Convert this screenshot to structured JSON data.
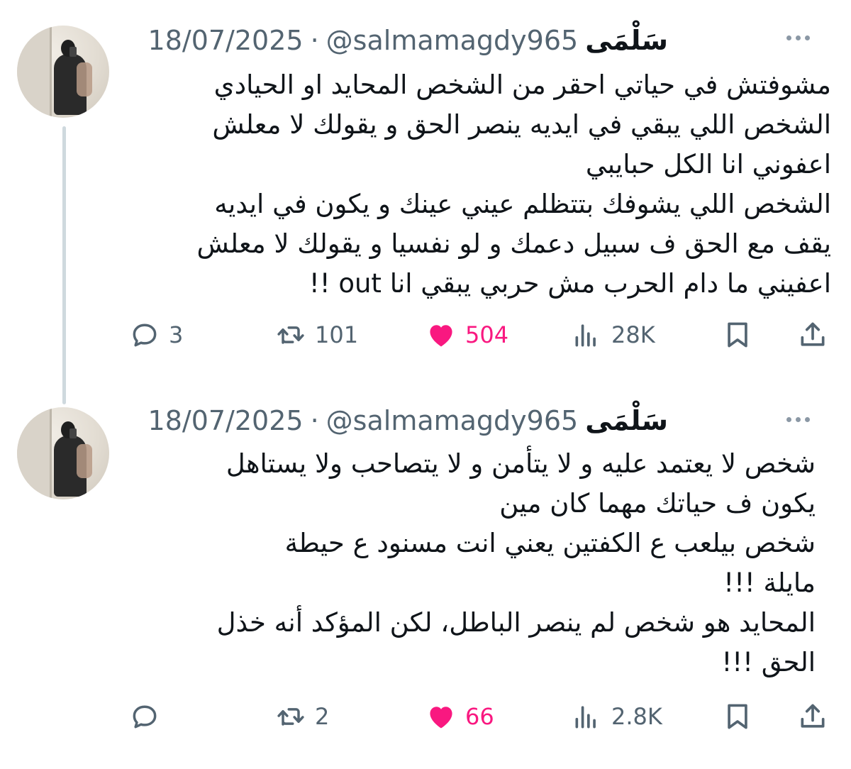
{
  "thread_line": true,
  "tweets": [
    {
      "display_name": "سَلْمَى",
      "handle": "@salmamagdy965",
      "separator": "·",
      "date": "18/07/2025",
      "text_lines": [
        "مشوفتش في حياتي احقر من الشخص المحايد او الحيادي",
        "الشخص اللي يبقي في ايديه ينصر الحق و يقولك لا معلش",
        "اعفوني انا الكل حبايبي",
        "الشخص اللي يشوفك بتتظلم عيني عينك و يكون في ايديه",
        "يقف مع الحق ف سبيل دعمك و لو نفسيا و يقولك لا معلش",
        "اعفيني ما دام الحرب مش حربي يبقي انا out !!"
      ],
      "replies": "3",
      "retweets": "101",
      "likes": "504",
      "views": "28K"
    },
    {
      "display_name": "سَلْمَى",
      "handle": "@salmamagdy965",
      "separator": "·",
      "date": "18/07/2025",
      "text_lines": [
        "شخص لا يعتمد عليه و لا يتأمن و لا يتصاحب ولا يستاهل",
        "يكون ف حياتك مهما كان مين",
        "شخص بيلعب ع الكفتين  يعني انت مسنود ع حيطة",
        "مايلة !!!",
        "المحايد هو شخص لم ينصر الباطل، لكن المؤكد أنه خذل",
        "الحق !!!"
      ],
      "replies": "",
      "retweets": "2",
      "likes": "66",
      "views": "2.8K"
    }
  ],
  "colors": {
    "text": "#0f1419",
    "muted": "#536471",
    "like": "#f91880",
    "thread": "#cfd9de"
  },
  "icons": [
    "reply-icon",
    "retweet-icon",
    "heart-icon",
    "views-icon",
    "bookmark-icon",
    "share-icon",
    "more-icon"
  ]
}
